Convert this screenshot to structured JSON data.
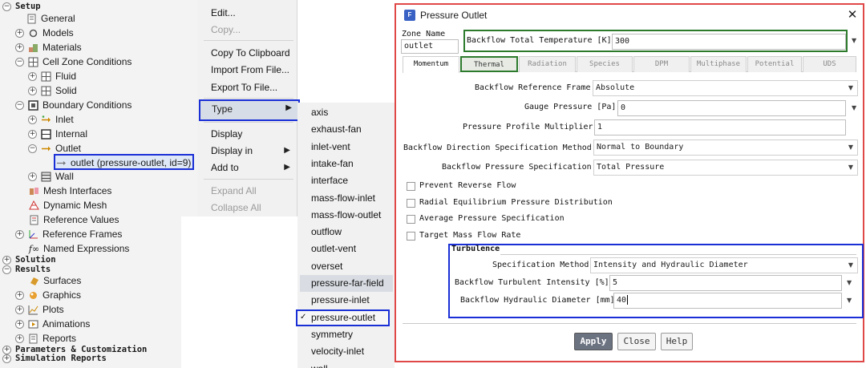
{
  "tree": {
    "setup": "Setup",
    "general": "General",
    "models": "Models",
    "materials": "Materials",
    "cell_zone_conditions": "Cell Zone Conditions",
    "fluid": "Fluid",
    "solid": "Solid",
    "boundary_conditions": "Boundary Conditions",
    "inlet": "Inlet",
    "internal": "Internal",
    "outlet": "Outlet",
    "outlet_item": "outlet (pressure-outlet, id=9)",
    "wall": "Wall",
    "mesh_interfaces": "Mesh Interfaces",
    "dynamic_mesh": "Dynamic Mesh",
    "reference_values": "Reference Values",
    "reference_frames": "Reference Frames",
    "named_expressions": "Named Expressions",
    "solution": "Solution",
    "results": "Results",
    "surfaces": "Surfaces",
    "graphics": "Graphics",
    "plots": "Plots",
    "animations": "Animations",
    "reports": "Reports",
    "parameters": "Parameters & Customization",
    "simulation_reports": "Simulation Reports"
  },
  "context_menu": {
    "edit": "Edit...",
    "copy": "Copy...",
    "copy_clipboard": "Copy To Clipboard",
    "import_file": "Import From File...",
    "export_file": "Export To File...",
    "type": "Type",
    "display": "Display",
    "display_in": "Display in",
    "add_to": "Add to",
    "expand_all": "Expand All",
    "collapse_all": "Collapse All"
  },
  "type_submenu": {
    "items": [
      "axis",
      "exhaust-fan",
      "inlet-vent",
      "intake-fan",
      "interface",
      "mass-flow-inlet",
      "mass-flow-outlet",
      "outflow",
      "outlet-vent",
      "overset",
      "pressure-far-field",
      "pressure-inlet",
      "pressure-outlet",
      "symmetry",
      "velocity-inlet",
      "wall"
    ],
    "checked": "pressure-outlet",
    "check_glyph": "✓"
  },
  "dialog": {
    "title": "Pressure Outlet",
    "zone_name_label": "Zone Name",
    "zone_name_value": "outlet",
    "backflow_temp_label": "Backflow Total Temperature [K]",
    "backflow_temp_value": "300",
    "tabs": [
      "Momentum",
      "Thermal",
      "Radiation",
      "Species",
      "DPM",
      "Multiphase",
      "Potential",
      "UDS"
    ],
    "active_tab": "Momentum",
    "backflow_ref_frame_label": "Backflow Reference Frame",
    "backflow_ref_frame_value": "Absolute",
    "gauge_pressure_label": "Gauge Pressure [Pa]",
    "gauge_pressure_value": "0",
    "pressure_profile_label": "Pressure Profile Multiplier",
    "pressure_profile_value": "1",
    "backflow_dir_label": "Backflow Direction Specification Method",
    "backflow_dir_value": "Normal to Boundary",
    "backflow_pressure_label": "Backflow Pressure Specification",
    "backflow_pressure_value": "Total Pressure",
    "prevent_reverse": "Prevent Reverse Flow",
    "radial_eq": "Radial Equilibrium Pressure Distribution",
    "avg_pressure": "Average Pressure Specification",
    "target_mass": "Target Mass Flow Rate",
    "turbulence_header": "Turbulence",
    "spec_method_label": "Specification Method",
    "spec_method_value": "Intensity and Hydraulic Diameter",
    "turb_intensity_label": "Backflow Turbulent Intensity [%]",
    "turb_intensity_value": "5",
    "hydraulic_diam_label": "Backflow Hydraulic Diameter [mm]",
    "hydraulic_diam_value": "40",
    "apply": "Apply",
    "close": "Close",
    "help": "Help"
  },
  "colors": {
    "highlight_blue": "#1a2fd6",
    "highlight_green": "#2d7a2d",
    "dialog_border": "#e04848"
  }
}
